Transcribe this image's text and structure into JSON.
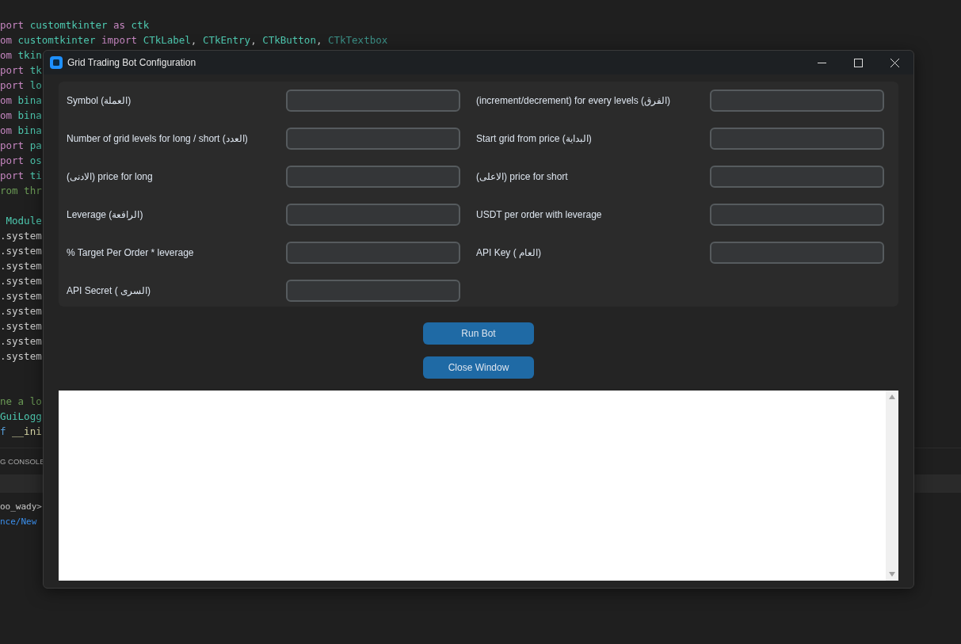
{
  "editor": {
    "code_blocks": [
      [
        [
          {
            "text": "port ",
            "kind": "kw"
          },
          {
            "text": "customtkinter ",
            "kind": "mod"
          },
          {
            "text": "as ",
            "kind": "kw"
          },
          {
            "text": "ctk",
            "kind": "mod"
          }
        ],
        [
          {
            "text": "om ",
            "kind": "kw"
          },
          {
            "text": "customtkinter ",
            "kind": "mod"
          },
          {
            "text": "import ",
            "kind": "kw"
          },
          {
            "text": "CTkLabel",
            "kind": "mod"
          },
          {
            "text": ", ",
            "kind": "plain"
          },
          {
            "text": "CTkEntry",
            "kind": "mod"
          },
          {
            "text": ", ",
            "kind": "plain"
          },
          {
            "text": "CTkButton",
            "kind": "mod"
          },
          {
            "text": ", ",
            "kind": "plain"
          },
          {
            "text": "CTkTextbox",
            "kind": "faded"
          }
        ],
        [
          {
            "text": "om ",
            "kind": "kw"
          },
          {
            "text": "tkin",
            "kind": "mod"
          }
        ],
        [
          {
            "text": "port ",
            "kind": "kw"
          },
          {
            "text": "tk",
            "kind": "mod"
          }
        ],
        [
          {
            "text": "port ",
            "kind": "kw"
          },
          {
            "text": "lo",
            "kind": "mod"
          }
        ],
        [
          {
            "text": "om ",
            "kind": "kw"
          },
          {
            "text": "bina",
            "kind": "mod"
          }
        ],
        [
          {
            "text": "om ",
            "kind": "kw"
          },
          {
            "text": "bina",
            "kind": "mod"
          }
        ],
        [
          {
            "text": "om ",
            "kind": "kw"
          },
          {
            "text": "bina",
            "kind": "mod"
          }
        ],
        [
          {
            "text": "port ",
            "kind": "kw"
          },
          {
            "text": "pa",
            "kind": "mod"
          }
        ],
        [
          {
            "text": "port ",
            "kind": "kw"
          },
          {
            "text": "os",
            "kind": "mod"
          }
        ],
        [
          {
            "text": "port ",
            "kind": "kw"
          },
          {
            "text": "ti",
            "kind": "mod"
          }
        ],
        [
          {
            "text": "rom thr",
            "kind": "comment"
          }
        ]
      ],
      [
        [
          {
            "text": " Module",
            "kind": "mod"
          }
        ],
        [
          {
            "text": ".system",
            "kind": "plain"
          }
        ],
        [
          {
            "text": ".system",
            "kind": "plain"
          }
        ],
        [
          {
            "text": ".system",
            "kind": "plain"
          }
        ],
        [
          {
            "text": ".system",
            "kind": "plain"
          }
        ],
        [
          {
            "text": ".system",
            "kind": "plain"
          }
        ],
        [
          {
            "text": ".system",
            "kind": "plain"
          }
        ],
        [
          {
            "text": ".system",
            "kind": "plain"
          }
        ],
        [
          {
            "text": ".system",
            "kind": "plain"
          }
        ],
        [
          {
            "text": ".system",
            "kind": "plain"
          }
        ]
      ],
      [
        [
          {
            "text": "ne a lo",
            "kind": "comment"
          }
        ],
        [
          {
            "text": "GuiLogg",
            "kind": "mod"
          }
        ],
        [
          {
            "text": "f ",
            "kind": "def"
          },
          {
            "text": "__ini",
            "kind": "fn"
          }
        ]
      ]
    ],
    "panel_tab": "G CONSOLE",
    "terminal_lines": [
      [
        {
          "text": "oo_wady>",
          "kind": "plain"
        }
      ],
      [
        {
          "text": "nce/New",
          "kind": "path"
        }
      ]
    ]
  },
  "window": {
    "title": "Grid Trading Bot Configuration",
    "fields": [
      {
        "label": "Symbol (العملة)"
      },
      {
        "label": "(increment/decrement) for every levels (الفرق)"
      },
      {
        "label": "Number of grid levels for long / short (العدد)"
      },
      {
        "label": "Start grid from price (البداية)"
      },
      {
        "label": "(الادنى) price for long"
      },
      {
        "label": "(الاعلى) price for short"
      },
      {
        "label": "Leverage (الرافعة)"
      },
      {
        "label": "USDT per order with leverage"
      },
      {
        "label": "% Target Per Order * leverage"
      },
      {
        "label": "API Key ( العام)"
      },
      {
        "label": "API Secret ( السرى)"
      }
    ],
    "buttons": [
      "Run Bot",
      "Close Window"
    ]
  }
}
